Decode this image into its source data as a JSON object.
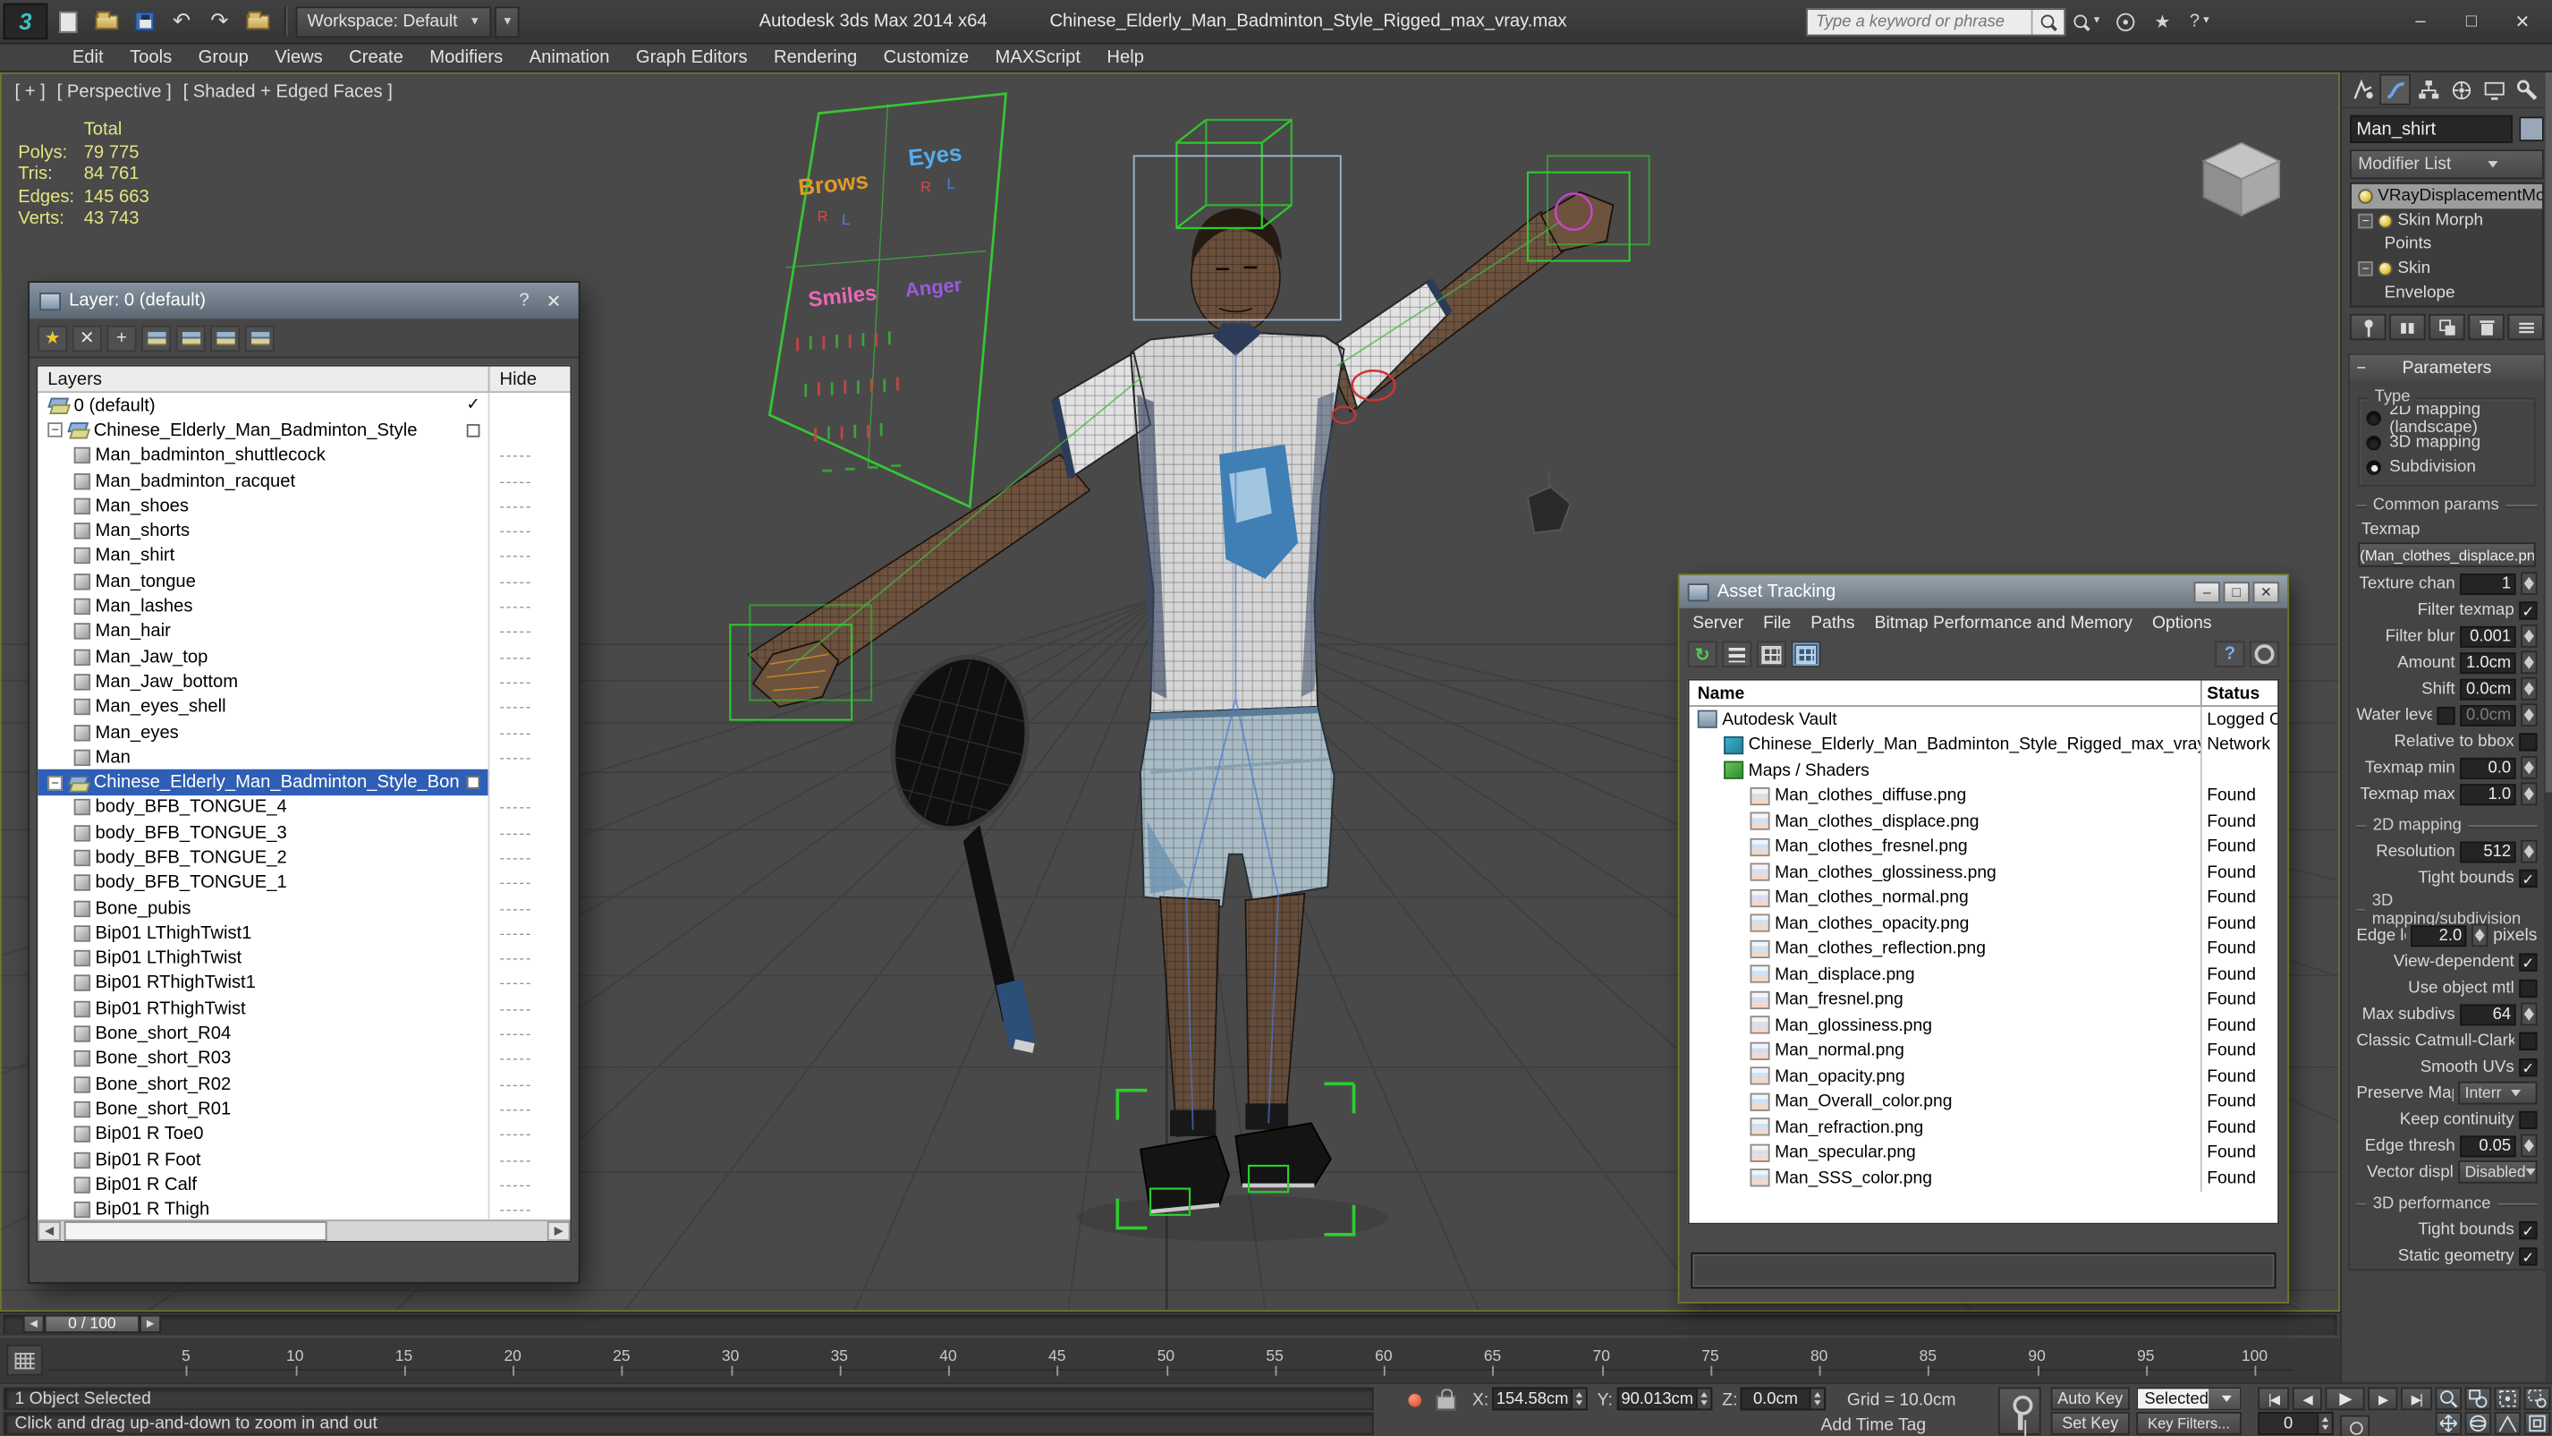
{
  "glyphs": {
    "check": "✓",
    "close": "✕",
    "minimize": "–",
    "maximize": "□",
    "help": "?",
    "dropdown": "▼",
    "undo": "↶",
    "redo": "↷",
    "expander_open": "−",
    "star": "★",
    "plus": "+",
    "refresh": "↻",
    "question": "?",
    "left": "◀",
    "right": "▶",
    "go_start": "|◀",
    "prev_frame": "◀",
    "play": "▶",
    "next_frame": "▶",
    "go_end": "▶|"
  },
  "colors": {
    "selection_blue": "#2e5eb5",
    "wireframe_green": "#2ecc2e",
    "stats_yellow": "#e4e480",
    "morph_green": "#38c434",
    "viewport_bg": "#494949"
  },
  "titlebar": {
    "workspace": "Workspace: Default",
    "app_title": "Autodesk 3ds Max 2014 x64",
    "doc_title": "Chinese_Elderly_Man_Badminton_Style_Rigged_max_vray.max",
    "search_placeholder": "Type a keyword or phrase"
  },
  "menubar": {
    "items": [
      "Edit",
      "Tools",
      "Group",
      "Views",
      "Create",
      "Modifiers",
      "Animation",
      "Graph Editors",
      "Rendering",
      "Customize",
      "MAXScript",
      "Help"
    ]
  },
  "viewport": {
    "label_plus": "[ + ]",
    "label_view": "[ Perspective ]",
    "label_shading": "[ Shaded + Edged Faces ]",
    "stats": {
      "total": "Total",
      "rows": [
        {
          "k": "Polys:",
          "v": "79 775"
        },
        {
          "k": "Tris:",
          "v": "84 761"
        },
        {
          "k": "Edges:",
          "v": "145 663"
        },
        {
          "k": "Verts:",
          "v": "43 743"
        }
      ]
    },
    "morph_board": {
      "brows": "Brows",
      "eyes": "Eyes",
      "smiles": "Smiles",
      "anger": "Anger",
      "l": "L",
      "r": "R"
    }
  },
  "layer_dialog": {
    "title": "Layer: 0 (default)",
    "columns": {
      "layers": "Layers",
      "hide": "Hide"
    },
    "toolbar": [
      "create-new-layer",
      "delete-layer",
      "add-selection-to-layer",
      "select-layer-objects",
      "highlight-layer",
      "hide-toggle",
      "freeze-toggle"
    ],
    "rows": [
      {
        "name": "0 (default)",
        "indent": 0,
        "icon": "layer",
        "hide": "check"
      },
      {
        "name": "Chinese_Elderly_Man_Badminton_Style",
        "indent": 0,
        "icon": "layer",
        "expander": true,
        "hide": "box"
      },
      {
        "name": "Man_badminton_shuttlecock",
        "indent": 1,
        "icon": "object",
        "hide": "dash"
      },
      {
        "name": "Man_badminton_racquet",
        "indent": 1,
        "icon": "object",
        "hide": "dash"
      },
      {
        "name": "Man_shoes",
        "indent": 1,
        "icon": "object",
        "hide": "dash"
      },
      {
        "name": "Man_shorts",
        "indent": 1,
        "icon": "object",
        "hide": "dash"
      },
      {
        "name": "Man_shirt",
        "indent": 1,
        "icon": "object",
        "hide": "dash"
      },
      {
        "name": "Man_tongue",
        "indent": 1,
        "icon": "object",
        "hide": "dash"
      },
      {
        "name": "Man_lashes",
        "indent": 1,
        "icon": "object",
        "hide": "dash"
      },
      {
        "name": "Man_hair",
        "indent": 1,
        "icon": "object",
        "hide": "dash"
      },
      {
        "name": "Man_Jaw_top",
        "indent": 1,
        "icon": "object",
        "hide": "dash"
      },
      {
        "name": "Man_Jaw_bottom",
        "indent": 1,
        "icon": "object",
        "hide": "dash"
      },
      {
        "name": "Man_eyes_shell",
        "indent": 1,
        "icon": "object",
        "hide": "dash"
      },
      {
        "name": "Man_eyes",
        "indent": 1,
        "icon": "object",
        "hide": "dash"
      },
      {
        "name": "Man",
        "indent": 1,
        "icon": "object",
        "hide": "dash"
      },
      {
        "name": "Chinese_Elderly_Man_Badminton_Style_Bones",
        "indent": 0,
        "icon": "layer",
        "expander": true,
        "selected": true,
        "hide": "box"
      },
      {
        "name": "body_BFB_TONGUE_4",
        "indent": 1,
        "icon": "object",
        "hide": "dash"
      },
      {
        "name": "body_BFB_TONGUE_3",
        "indent": 1,
        "icon": "object",
        "hide": "dash"
      },
      {
        "name": "body_BFB_TONGUE_2",
        "indent": 1,
        "icon": "object",
        "hide": "dash"
      },
      {
        "name": "body_BFB_TONGUE_1",
        "indent": 1,
        "icon": "object",
        "hide": "dash"
      },
      {
        "name": "Bone_pubis",
        "indent": 1,
        "icon": "object",
        "hide": "dash"
      },
      {
        "name": "Bip01 LThighTwist1",
        "indent": 1,
        "icon": "object",
        "hide": "dash"
      },
      {
        "name": "Bip01 LThighTwist",
        "indent": 1,
        "icon": "object",
        "hide": "dash"
      },
      {
        "name": "Bip01 RThighTwist1",
        "indent": 1,
        "icon": "object",
        "hide": "dash"
      },
      {
        "name": "Bip01 RThighTwist",
        "indent": 1,
        "icon": "object",
        "hide": "dash"
      },
      {
        "name": "Bone_short_R04",
        "indent": 1,
        "icon": "object",
        "hide": "dash"
      },
      {
        "name": "Bone_short_R03",
        "indent": 1,
        "icon": "object",
        "hide": "dash"
      },
      {
        "name": "Bone_short_R02",
        "indent": 1,
        "icon": "object",
        "hide": "dash"
      },
      {
        "name": "Bone_short_R01",
        "indent": 1,
        "icon": "object",
        "hide": "dash"
      },
      {
        "name": "Bip01 R Toe0",
        "indent": 1,
        "icon": "object",
        "hide": "dash"
      },
      {
        "name": "Bip01 R Foot",
        "indent": 1,
        "icon": "object",
        "hide": "dash"
      },
      {
        "name": "Bip01 R Calf",
        "indent": 1,
        "icon": "object",
        "hide": "dash"
      },
      {
        "name": "Bip01 R Thigh",
        "indent": 1,
        "icon": "object",
        "hide": "dash"
      }
    ]
  },
  "asset_tracking": {
    "title": "Asset Tracking",
    "menus": [
      "Server",
      "File",
      "Paths",
      "Bitmap Performance and Memory",
      "Options"
    ],
    "toolbar_left": [
      "refresh",
      "report-view",
      "table-view",
      "thumbnail-view"
    ],
    "toolbar_right": [
      "help",
      "settings"
    ],
    "columns": {
      "name": "Name",
      "status": "Status"
    },
    "rows": [
      {
        "name": "Autodesk Vault",
        "status": "Logged O",
        "indent": 0,
        "icon": "vault"
      },
      {
        "name": "Chinese_Elderly_Man_Badminton_Style_Rigged_max_vray.max",
        "status": "Network",
        "indent": 1,
        "icon": "max"
      },
      {
        "name": "Maps / Shaders",
        "status": "",
        "indent": 1,
        "icon": "maps"
      },
      {
        "name": "Man_clothes_diffuse.png",
        "status": "Found",
        "indent": 2,
        "icon": "png"
      },
      {
        "name": "Man_clothes_displace.png",
        "status": "Found",
        "indent": 2,
        "icon": "png"
      },
      {
        "name": "Man_clothes_fresnel.png",
        "status": "Found",
        "indent": 2,
        "icon": "png"
      },
      {
        "name": "Man_clothes_glossiness.png",
        "status": "Found",
        "indent": 2,
        "icon": "png"
      },
      {
        "name": "Man_clothes_normal.png",
        "status": "Found",
        "indent": 2,
        "icon": "png"
      },
      {
        "name": "Man_clothes_opacity.png",
        "status": "Found",
        "indent": 2,
        "icon": "png"
      },
      {
        "name": "Man_clothes_reflection.png",
        "status": "Found",
        "indent": 2,
        "icon": "png"
      },
      {
        "name": "Man_displace.png",
        "status": "Found",
        "indent": 2,
        "icon": "png"
      },
      {
        "name": "Man_fresnel.png",
        "status": "Found",
        "indent": 2,
        "icon": "png"
      },
      {
        "name": "Man_glossiness.png",
        "status": "Found",
        "indent": 2,
        "icon": "png"
      },
      {
        "name": "Man_normal.png",
        "status": "Found",
        "indent": 2,
        "icon": "png"
      },
      {
        "name": "Man_opacity.png",
        "status": "Found",
        "indent": 2,
        "icon": "png"
      },
      {
        "name": "Man_Overall_color.png",
        "status": "Found",
        "indent": 2,
        "icon": "png"
      },
      {
        "name": "Man_refraction.png",
        "status": "Found",
        "indent": 2,
        "icon": "png"
      },
      {
        "name": "Man_specular.png",
        "status": "Found",
        "indent": 2,
        "icon": "png"
      },
      {
        "name": "Man_SSS_color.png",
        "status": "Found",
        "indent": 2,
        "icon": "png"
      }
    ]
  },
  "command_panel": {
    "tabs": [
      "create",
      "modify",
      "hierarchy",
      "motion",
      "display",
      "utilities"
    ],
    "active_tab": "modify",
    "object_name": "Man_shirt",
    "modifier_list": "Modifier List",
    "stack": [
      {
        "label": "VRayDisplacementMod",
        "indent": 0,
        "bulb": true,
        "selected": true
      },
      {
        "label": "Skin Morph",
        "indent": 0,
        "bulb": true,
        "expander": true
      },
      {
        "label": "Points",
        "indent": 1
      },
      {
        "label": "Skin",
        "indent": 0,
        "bulb": true,
        "expander": true
      },
      {
        "label": "Envelope",
        "indent": 1
      }
    ],
    "stack_buttons": [
      "pin-stack",
      "show-end-result",
      "make-unique",
      "remove-modifier",
      "configure-modifier-sets"
    ],
    "parameters": {
      "title": "Parameters",
      "type_label": "Type",
      "type_options": [
        {
          "label": "2D mapping (landscape)",
          "selected": false
        },
        {
          "label": "3D mapping",
          "selected": false
        },
        {
          "label": "Subdivision",
          "selected": true
        }
      ],
      "controls": [
        {
          "t": "group",
          "label": "Common params"
        },
        {
          "t": "label",
          "label": "Texmap"
        },
        {
          "t": "button",
          "label": "(Man_clothes_displace.png)"
        },
        {
          "t": "spin",
          "label": "Texture chan",
          "value": "1"
        },
        {
          "t": "check",
          "label": "Filter texmap",
          "checked": true
        },
        {
          "t": "spin",
          "label": "Filter blur",
          "value": "0.001"
        },
        {
          "t": "spin",
          "label": "Amount",
          "value": "1.0cm"
        },
        {
          "t": "spin",
          "label": "Shift",
          "value": "0.0cm"
        },
        {
          "t": "checkspin",
          "label": "Water level",
          "checked": false,
          "value": "0.0cm",
          "disabled": true
        },
        {
          "t": "check",
          "label": "Relative to bbox",
          "checked": false
        },
        {
          "t": "spin",
          "label": "Texmap min",
          "value": "0.0"
        },
        {
          "t": "spin",
          "label": "Texmap max",
          "value": "1.0"
        },
        {
          "t": "group",
          "label": "2D mapping"
        },
        {
          "t": "spin",
          "label": "Resolution",
          "value": "512"
        },
        {
          "t": "check",
          "label": "Tight bounds",
          "checked": true
        },
        {
          "t": "group",
          "label": "3D mapping/subdivision"
        },
        {
          "t": "spin",
          "label": "Edge length",
          "value": "2.0",
          "suffix": "pixels"
        },
        {
          "t": "check",
          "label": "View-dependent",
          "checked": true
        },
        {
          "t": "check",
          "label": "Use object mtl",
          "checked": false
        },
        {
          "t": "spin",
          "label": "Max subdivs",
          "value": "64"
        },
        {
          "t": "check",
          "label": "Classic Catmull-Clark",
          "checked": false
        },
        {
          "t": "check",
          "label": "Smooth UVs",
          "checked": true
        },
        {
          "t": "dropdown",
          "label": "Preserve Map Bnd",
          "value": "Interr"
        },
        {
          "t": "check",
          "label": "Keep continuity",
          "checked": false
        },
        {
          "t": "spin",
          "label": "Edge thresh",
          "value": "0.05"
        },
        {
          "t": "dropdown",
          "label": "Vector displ",
          "value": "Disabled"
        },
        {
          "t": "group",
          "label": "3D performance"
        },
        {
          "t": "check",
          "label": "Tight bounds",
          "checked": true
        },
        {
          "t": "check",
          "label": "Static geometry",
          "checked": true
        }
      ]
    }
  },
  "timeline": {
    "slider": "0 / 100",
    "ruler": {
      "start": 0,
      "end": 100,
      "step": 5,
      "first_label": 5
    }
  },
  "status_bar": {
    "status": "1 Object Selected",
    "prompt": "Click and drag up-and-down to zoom in and out",
    "coords": {
      "x_label": "X:",
      "x": "154.58cm",
      "y_label": "Y:",
      "y": "90.013cm",
      "z_label": "Z:",
      "z": "0.0cm"
    },
    "grid": "Grid = 10.0cm",
    "frame": "0",
    "add_time_tag": "Add Time Tag",
    "auto_key": "Auto Key",
    "set_key": "Set Key",
    "selected_set": "Selected",
    "key_filters": "Key Filters..."
  }
}
